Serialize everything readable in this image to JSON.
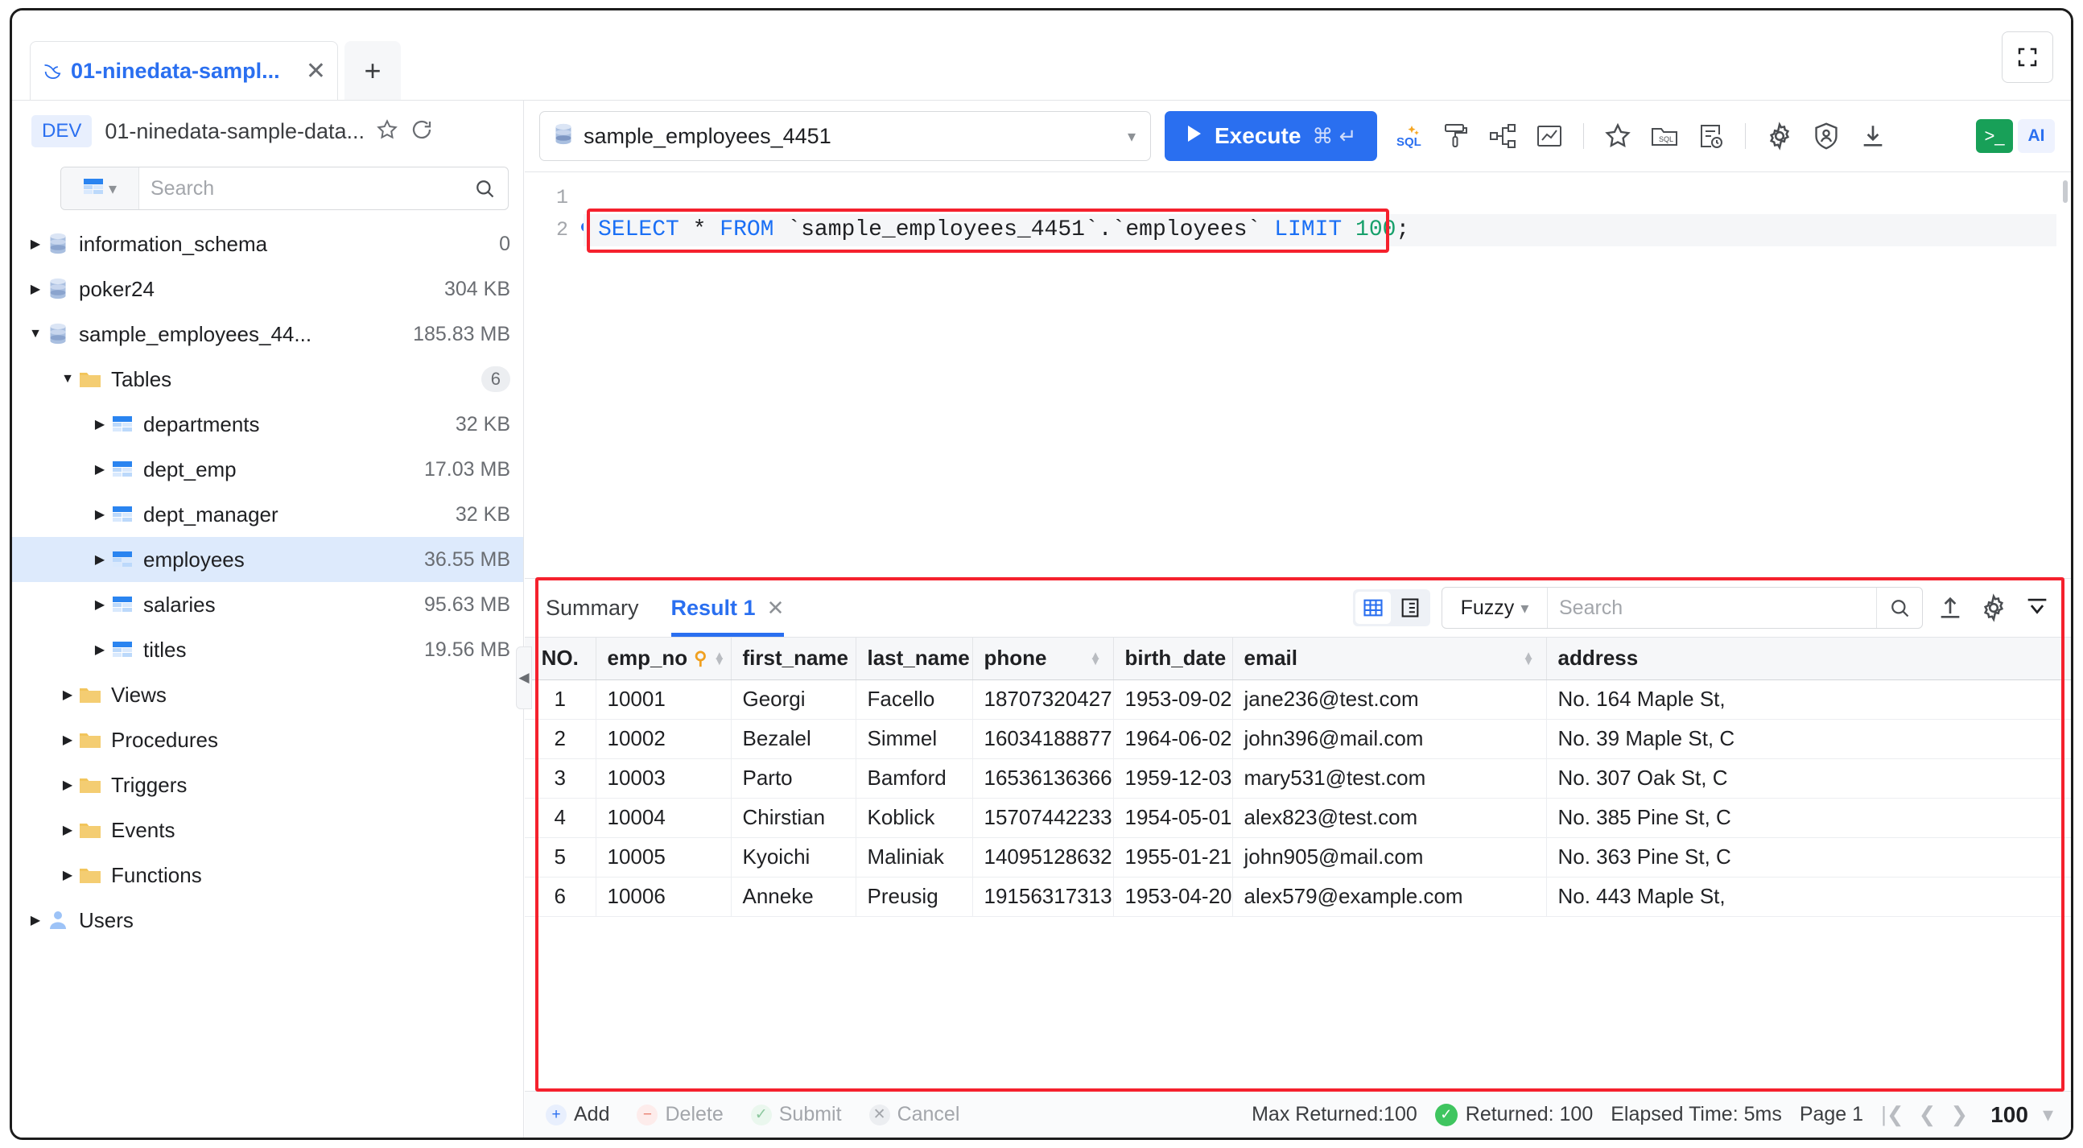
{
  "window": {
    "tab": {
      "title": "01-ninedata-sampl...",
      "icon": "dolphin-icon",
      "close_label": "✕"
    },
    "new_tab_label": "+",
    "fullscreen_icon": "fullscreen-icon"
  },
  "sidebar": {
    "env_badge": "DEV",
    "connection_name": "01-ninedata-sample-data...",
    "favorite_icon": "star-icon",
    "refresh_icon": "refresh-icon",
    "search": {
      "placeholder": "Search",
      "value": "",
      "type_icon": "table-icon",
      "go_icon": "search-icon"
    },
    "tree": [
      {
        "label": "information_schema",
        "size": "0",
        "icon": "database-icon",
        "depth": 0,
        "expanded": false,
        "selected": false
      },
      {
        "label": "poker24",
        "size": "304 KB",
        "icon": "database-icon",
        "depth": 0,
        "expanded": false,
        "selected": false
      },
      {
        "label": "sample_employees_44...",
        "size": "185.83 MB",
        "icon": "database-icon",
        "depth": 0,
        "expanded": true,
        "selected": false
      },
      {
        "label": "Tables",
        "count": "6",
        "icon": "folder-icon",
        "depth": 1,
        "expanded": true,
        "selected": false
      },
      {
        "label": "departments",
        "size": "32 KB",
        "icon": "table-icon",
        "depth": 2,
        "expanded": false,
        "selected": false
      },
      {
        "label": "dept_emp",
        "size": "17.03 MB",
        "icon": "table-icon",
        "depth": 2,
        "expanded": false,
        "selected": false
      },
      {
        "label": "dept_manager",
        "size": "32 KB",
        "icon": "table-icon",
        "depth": 2,
        "expanded": false,
        "selected": false
      },
      {
        "label": "employees",
        "size": "36.55 MB",
        "icon": "table-icon",
        "depth": 2,
        "expanded": false,
        "selected": true
      },
      {
        "label": "salaries",
        "size": "95.63 MB",
        "icon": "table-icon",
        "depth": 2,
        "expanded": false,
        "selected": false
      },
      {
        "label": "titles",
        "size": "19.56 MB",
        "icon": "table-icon",
        "depth": 2,
        "expanded": false,
        "selected": false
      },
      {
        "label": "Views",
        "icon": "folder-icon",
        "depth": 1,
        "expanded": false,
        "selected": false
      },
      {
        "label": "Procedures",
        "icon": "folder-icon",
        "depth": 1,
        "expanded": false,
        "selected": false
      },
      {
        "label": "Triggers",
        "icon": "folder-icon",
        "depth": 1,
        "expanded": false,
        "selected": false
      },
      {
        "label": "Events",
        "icon": "folder-icon",
        "depth": 1,
        "expanded": false,
        "selected": false
      },
      {
        "label": "Functions",
        "icon": "folder-icon",
        "depth": 1,
        "expanded": false,
        "selected": false
      },
      {
        "label": "Users",
        "icon": "user-icon",
        "depth": 0,
        "expanded": false,
        "selected": false
      }
    ],
    "collapse_handle_icon": "chevron-left-icon"
  },
  "toolbar": {
    "database_selected": "sample_employees_4451",
    "database_icon": "database-icon",
    "execute_label": "Execute",
    "execute_shortcut": "⌘ ↵",
    "icons": [
      {
        "name": "sql-format-icon",
        "label": "SQL"
      },
      {
        "name": "paint-roller-icon"
      },
      {
        "name": "structure-icon"
      },
      {
        "name": "chart-icon"
      },
      {
        "name": "favorite-star-icon"
      },
      {
        "name": "sql-folder-icon"
      },
      {
        "name": "history-icon"
      },
      {
        "name": "settings-gear-icon"
      },
      {
        "name": "security-shield-icon"
      },
      {
        "name": "download-icon"
      }
    ],
    "terminal_badge": ">_",
    "ai_badge": "AI"
  },
  "editor": {
    "line_numbers": [
      "1",
      "2"
    ],
    "sql": {
      "full": "SELECT * FROM `sample_employees_4451`.`employees` LIMIT 100;",
      "tokens": [
        {
          "t": "SELECT",
          "c": "kw"
        },
        {
          "t": " ",
          "c": "op"
        },
        {
          "t": "*",
          "c": "op"
        },
        {
          "t": " ",
          "c": "op"
        },
        {
          "t": "FROM",
          "c": "kw"
        },
        {
          "t": " `sample_employees_4451`.`employees` ",
          "c": "ident"
        },
        {
          "t": "LIMIT",
          "c": "kw"
        },
        {
          "t": " ",
          "c": "op"
        },
        {
          "t": "100",
          "c": "num"
        },
        {
          "t": ";",
          "c": "op"
        }
      ]
    }
  },
  "results": {
    "tabs": [
      {
        "label": "Summary",
        "active": false,
        "closable": false
      },
      {
        "label": "Result 1",
        "active": true,
        "closable": true,
        "close_label": "✕"
      }
    ],
    "view_modes": [
      {
        "name": "grid-view-icon",
        "active": true
      },
      {
        "name": "form-view-icon",
        "active": false
      }
    ],
    "search": {
      "mode": "Fuzzy",
      "placeholder": "Search",
      "value": "",
      "go_icon": "search-icon"
    },
    "actions": [
      {
        "name": "export-upload-icon"
      },
      {
        "name": "settings-gear-icon"
      },
      {
        "name": "collapse-panel-icon"
      }
    ],
    "columns": [
      {
        "label": "NO.",
        "sortable": false,
        "key": false
      },
      {
        "label": "emp_no",
        "sortable": true,
        "key": true
      },
      {
        "label": "first_name",
        "sortable": true,
        "key": false
      },
      {
        "label": "last_name",
        "sortable": true,
        "key": false
      },
      {
        "label": "phone",
        "sortable": true,
        "key": false
      },
      {
        "label": "birth_date",
        "sortable": true,
        "key": false
      },
      {
        "label": "email",
        "sortable": true,
        "key": false
      },
      {
        "label": "address",
        "sortable": false,
        "key": false
      }
    ],
    "rows": [
      [
        "1",
        "10001",
        "Georgi",
        "Facello",
        "18707320427",
        "1953-09-02",
        "jane236@test.com",
        "No. 164 Maple St, "
      ],
      [
        "2",
        "10002",
        "Bezalel",
        "Simmel",
        "16034188877",
        "1964-06-02",
        "john396@mail.com",
        "No. 39 Maple St, C"
      ],
      [
        "3",
        "10003",
        "Parto",
        "Bamford",
        "16536136366",
        "1959-12-03",
        "mary531@test.com",
        "No. 307 Oak St, C"
      ],
      [
        "4",
        "10004",
        "Chirstian",
        "Koblick",
        "15707442233",
        "1954-05-01",
        "alex823@test.com",
        "No. 385 Pine St, C"
      ],
      [
        "5",
        "10005",
        "Kyoichi",
        "Maliniak",
        "14095128632",
        "1955-01-21",
        "john905@mail.com",
        "No. 363 Pine St, C"
      ],
      [
        "6",
        "10006",
        "Anneke",
        "Preusig",
        "19156317313",
        "1953-04-20",
        "alex579@example.com",
        "No. 443 Maple St,"
      ]
    ]
  },
  "statusbar": {
    "actions": [
      {
        "label": "Add",
        "glyph": "+",
        "enabled": true,
        "name": "add-row-button"
      },
      {
        "label": "Delete",
        "glyph": "−",
        "enabled": false,
        "name": "delete-row-button"
      },
      {
        "label": "Submit",
        "glyph": "✓",
        "enabled": false,
        "name": "submit-button"
      },
      {
        "label": "Cancel",
        "glyph": "✕",
        "enabled": false,
        "name": "cancel-button"
      }
    ],
    "max_returned": "Max Returned:100",
    "returned": "Returned: 100",
    "elapsed": "Elapsed Time: 5ms",
    "page": "Page 1",
    "page_size": "100",
    "first_icon": "first-page-icon",
    "prev_icon": "prev-page-icon",
    "next_icon": "next-page-icon",
    "size_chevron": "chevron-down-icon"
  },
  "colors": {
    "accent": "#2a6ff0",
    "highlight_red": "#f5212d",
    "selected_row": "#ddeafc",
    "success_green": "#3fc55f"
  }
}
